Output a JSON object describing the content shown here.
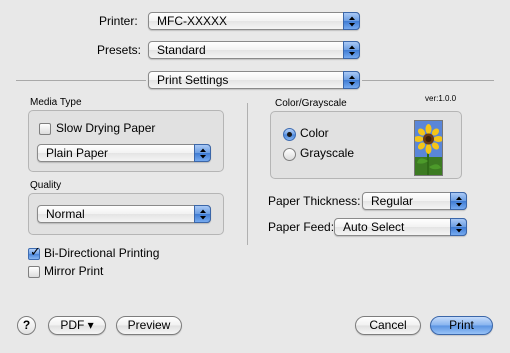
{
  "header": {
    "printer_label": "Printer:",
    "printer_value": "MFC-XXXXX",
    "presets_label": "Presets:",
    "presets_value": "Standard",
    "panel_value": "Print Settings"
  },
  "media_type": {
    "title": "Media Type",
    "slow_drying_label": "Slow Drying Paper",
    "slow_drying_checked": false,
    "paper_value": "Plain Paper"
  },
  "quality": {
    "title": "Quality",
    "value": "Normal"
  },
  "options": {
    "bidirectional_label": "Bi-Directional Printing",
    "bidirectional_checked": true,
    "mirror_label": "Mirror Print",
    "mirror_checked": false
  },
  "color_group": {
    "title": "Color/Grayscale",
    "version": "ver:1.0.0",
    "color_label": "Color",
    "grayscale_label": "Grayscale",
    "selected": "Color"
  },
  "paper": {
    "thickness_label": "Paper Thickness:",
    "thickness_value": "Regular",
    "feed_label": "Paper Feed:",
    "feed_value": "Auto Select"
  },
  "footer": {
    "help_label": "?",
    "pdf_label": "PDF ▾",
    "preview_label": "Preview",
    "cancel_label": "Cancel",
    "print_label": "Print"
  },
  "colors": {
    "accent": "#4a85da",
    "window_bg": "#e8e8e8"
  }
}
